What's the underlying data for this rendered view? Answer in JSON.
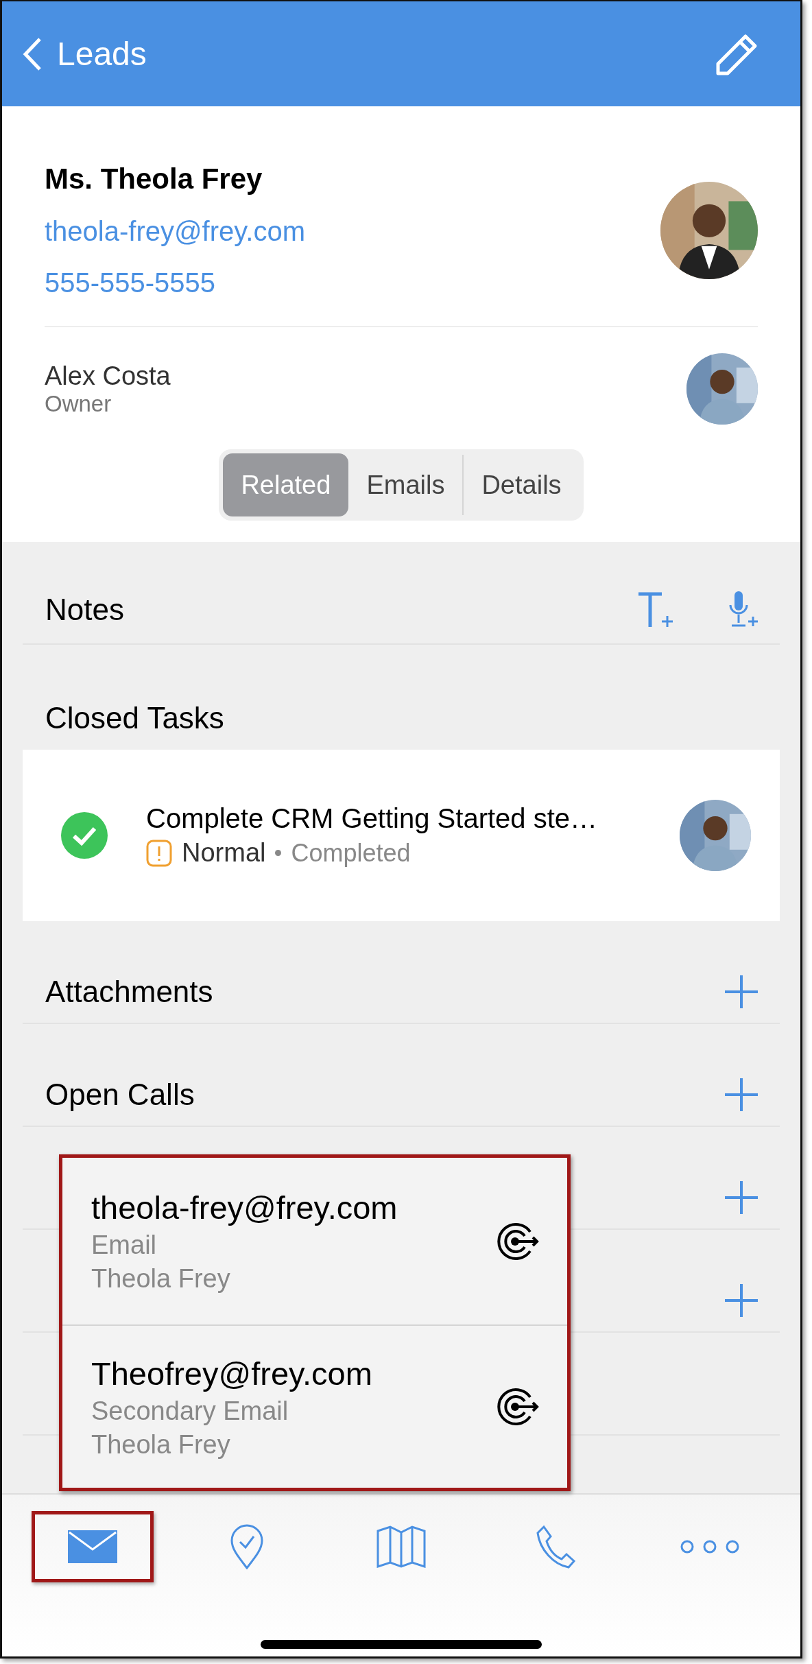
{
  "header": {
    "back_label": "Leads"
  },
  "contact": {
    "name": "Ms. Theola Frey",
    "email": "theola-frey@frey.com",
    "phone": "555-555-5555"
  },
  "owner": {
    "name": "Alex Costa",
    "role": "Owner"
  },
  "segments": [
    {
      "label": "Related",
      "selected": true
    },
    {
      "label": "Emails",
      "selected": false
    },
    {
      "label": "Details",
      "selected": false
    }
  ],
  "sections": [
    {
      "kind": "notes",
      "title": "Notes"
    },
    {
      "kind": "tasks",
      "title": "Closed Tasks",
      "tasks": [
        {
          "title": "Complete CRM Getting Started ste…",
          "completed": true,
          "priority": "Normal",
          "status": "Completed"
        }
      ]
    },
    {
      "kind": "add",
      "title": "Attachments"
    },
    {
      "kind": "add",
      "title": "Open Calls"
    },
    {
      "kind": "add"
    },
    {
      "kind": "add"
    },
    {
      "kind": "plain"
    }
  ],
  "popup": [
    {
      "address": "theola-frey@frey.com",
      "type": "Email",
      "name": "Theola Frey"
    },
    {
      "address": "Theofrey@frey.com",
      "type": "Secondary Email",
      "name": "Theola Frey"
    }
  ],
  "tab_bar": [
    {
      "kind": "mail",
      "selected": true
    },
    {
      "kind": "checkin",
      "selected": false
    },
    {
      "kind": "map",
      "selected": false
    },
    {
      "kind": "phone",
      "selected": false
    },
    {
      "kind": "more",
      "selected": false
    }
  ]
}
